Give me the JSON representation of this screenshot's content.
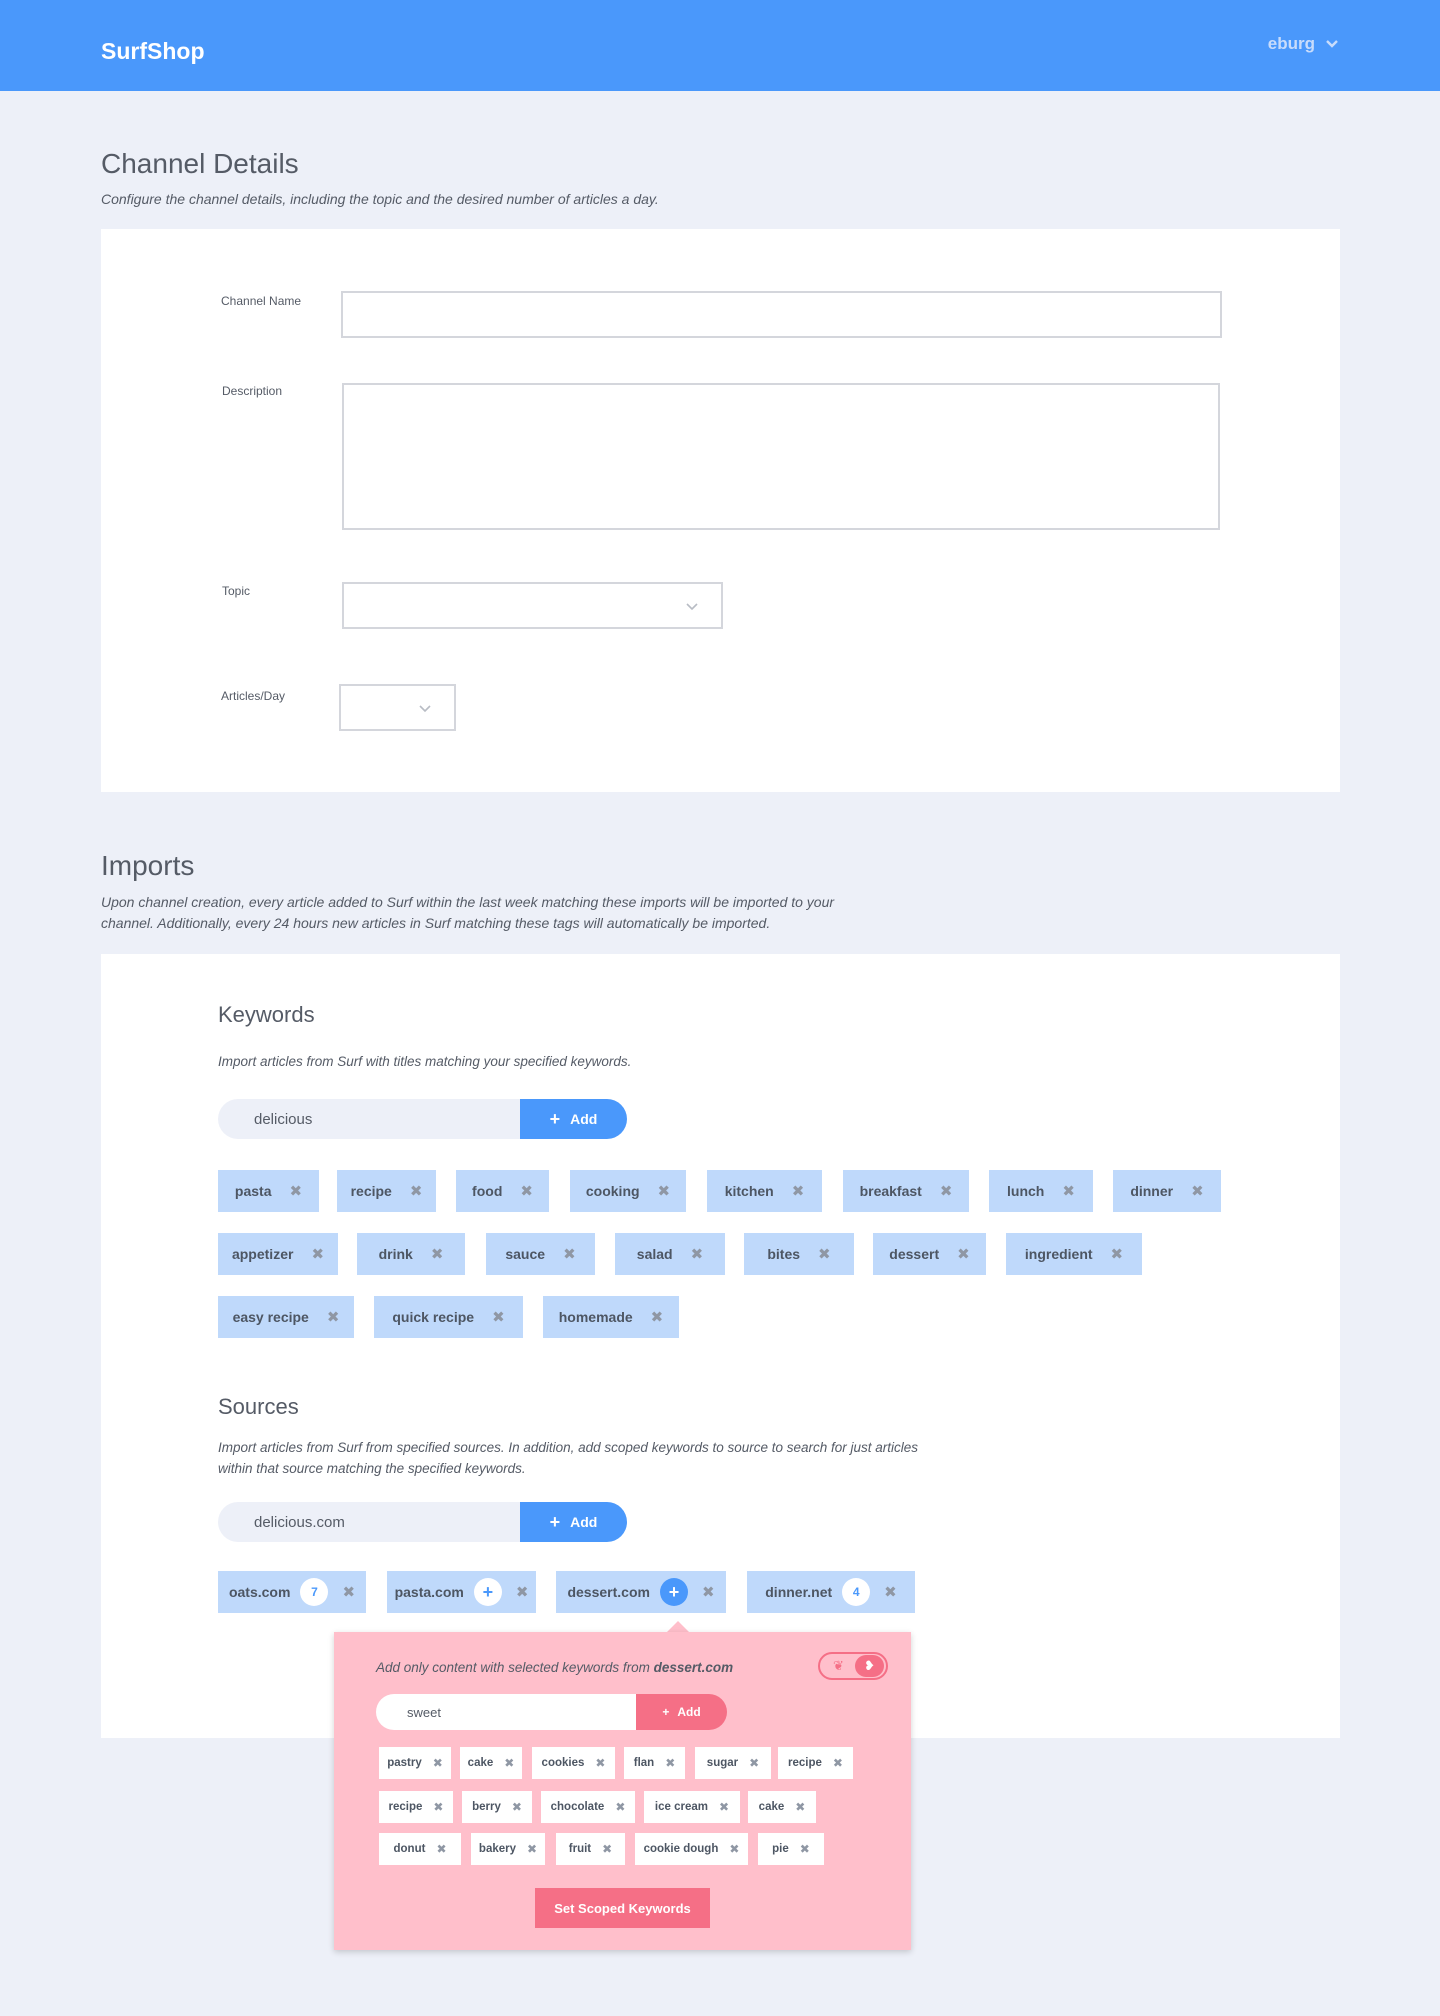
{
  "header": {
    "brand": "SurfShop",
    "user": "eburg"
  },
  "channel": {
    "title": "Channel Details",
    "desc": "Configure the channel details, including the topic and the desired number of articles a day.",
    "name_label": "Channel Name",
    "name_value": "",
    "description_label": "Description",
    "description_value": "",
    "topic_label": "Topic",
    "topic_value": "",
    "articles_label": "Articles/Day",
    "articles_value": ""
  },
  "imports": {
    "title": "Imports",
    "desc_line1": "Upon channel creation, every article added to Surf within the last week matching these imports will be imported to your",
    "desc_line2": "channel. Additionally, every 24 hours new articles in Surf matching these tags will automatically be imported."
  },
  "keywords": {
    "title": "Keywords",
    "desc": "Import articles from Surf with titles matching your specified keywords.",
    "input_value": "delicious",
    "add_label": "Add",
    "tags": [
      "pasta",
      "recipe",
      "food",
      "cooking",
      "kitchen",
      "breakfast",
      "lunch",
      "dinner",
      "appetizer",
      "drink",
      "sauce",
      "salad",
      "bites",
      "dessert",
      "ingredient",
      "easy recipe",
      "quick recipe",
      "homemade"
    ]
  },
  "sources": {
    "title": "Sources",
    "desc_line1": "Import articles from Surf from specified sources. In addition, add scoped keywords to source to search for just articles",
    "desc_line2": "within that source matching the specified keywords.",
    "input_value": "delicious.com",
    "add_label": "Add",
    "items": [
      {
        "name": "oats.com",
        "badge": "7"
      },
      {
        "name": "pasta.com",
        "badge": "+"
      },
      {
        "name": "dessert.com",
        "badge": "+"
      },
      {
        "name": "dinner.net",
        "badge": "4"
      }
    ]
  },
  "popup": {
    "desc_prefix": "Add only content with selected keywords from ",
    "desc_source": "dessert.com",
    "input_value": "sweet",
    "add_label": "Add",
    "tags": [
      "pastry",
      "cake",
      "cookies",
      "flan",
      "sugar",
      "recipe",
      "recipe",
      "berry",
      "chocolate",
      "ice cream",
      "cake",
      "donut",
      "bakery",
      "fruit",
      "cookie dough",
      "pie"
    ],
    "button_label": "Set Scoped Keywords"
  },
  "icons": {
    "remove": "close-icon",
    "dropdown": "chevron-down-icon",
    "add": "plus-icon"
  },
  "colors": {
    "primary": "#4a98fb",
    "tag": "#bfd9fb",
    "popup": "#ffbfcb",
    "accent_pink": "#f56f86",
    "background": "#edf0f8"
  }
}
